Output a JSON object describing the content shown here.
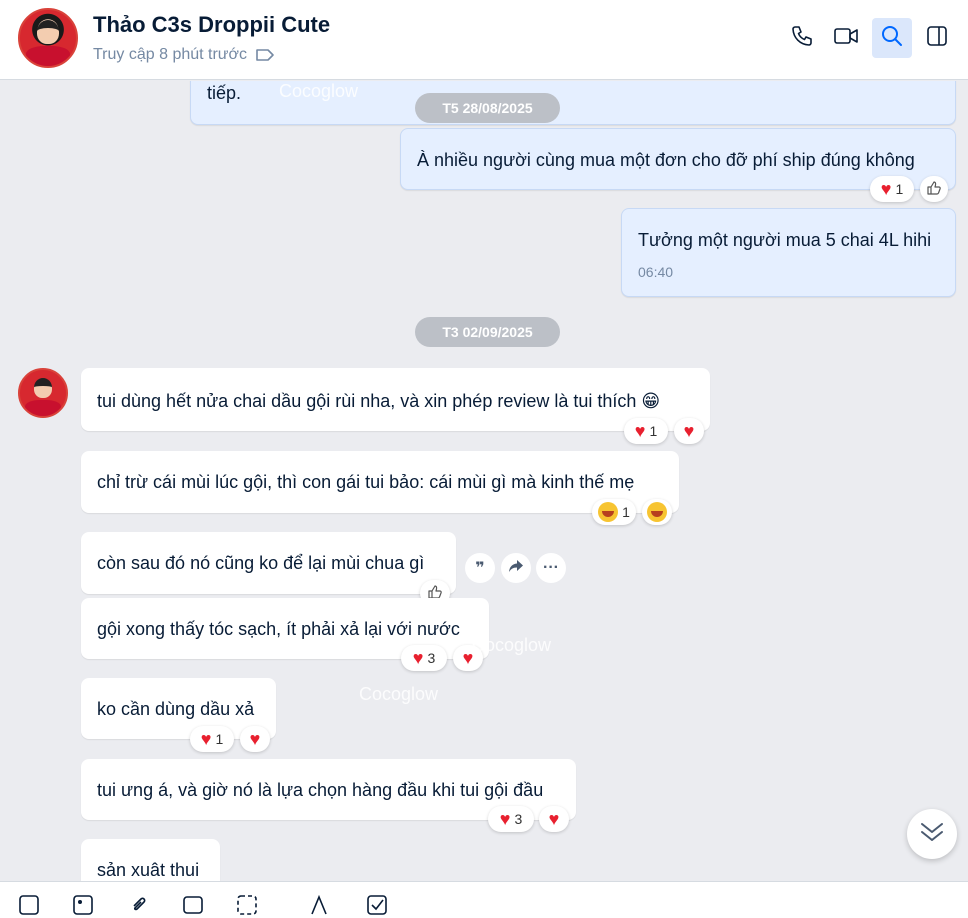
{
  "header": {
    "name": "Thảo C3s Droppii Cute",
    "status": "Truy cập 8 phút trước"
  },
  "messages": {
    "m0_tail": "tiếp.",
    "m1": "À nhiều người cùng mua một đơn cho đỡ phí ship đúng không",
    "m1_react_count": "1",
    "m2": "Tưởng một người mua 5 chai 4L hihi",
    "m2_time": "06:40",
    "t1": "tui dùng hết nửa chai dầu gội rùi nha, và xin phép review là tui thích 😁",
    "t1_react_count": "1",
    "t2": "chỉ trừ cái mùi lúc gội, thì con gái tui bảo: cái mùi gì mà kinh thế mẹ",
    "t2_react_count": "1",
    "t3": "còn sau đó nó cũng ko để lại mùi chua gì",
    "t4": "gội xong thấy tóc sạch, ít phải xả lại với nước",
    "t4_react_count": "3",
    "t5": "ko cần dùng dầu xả",
    "t5_react_count": "1",
    "t6": "tui ưng á, và giờ nó là lựa chọn hàng đầu khi tui gội đầu",
    "t6_react_count": "3",
    "t7": "sản xuât thui"
  },
  "dates": {
    "d1": "T5 28/08/2025",
    "d2": "T3 02/09/2025"
  },
  "watermark": "Cocoglow",
  "icons": [
    "phone-icon",
    "video-icon",
    "search-icon",
    "sidebar-toggle-icon",
    "tag-icon",
    "quote-icon",
    "forward-icon",
    "more-icon",
    "like-icon",
    "chevron-down-icon"
  ],
  "colors": {
    "accent": "#0068ff",
    "my_bubble": "#e5efff",
    "heart": "#e8202f"
  }
}
